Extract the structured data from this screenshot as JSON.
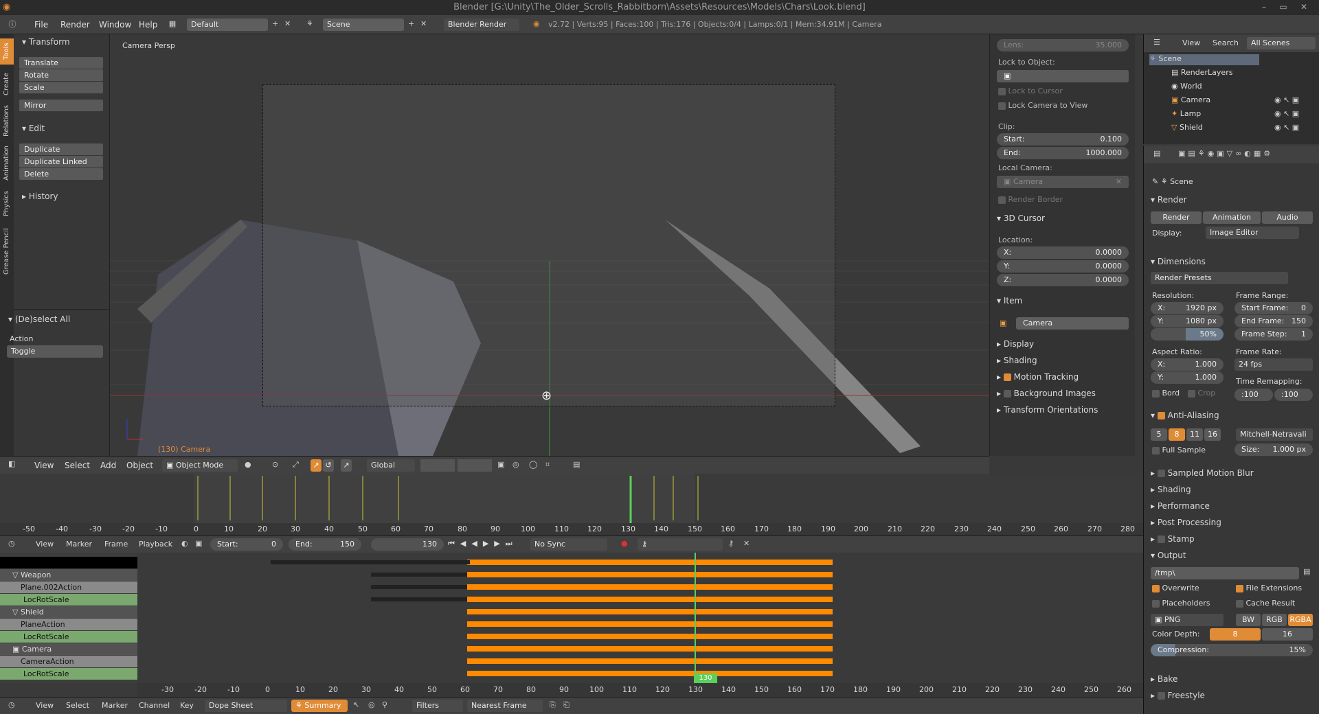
{
  "window": {
    "title": "Blender [G:\\Unity\\The_Older_Scrolls_Rabbitborn\\Assets\\Resources\\Models\\Chars\\Look.blend]"
  },
  "topbar": {
    "menus": [
      "File",
      "Render",
      "Window",
      "Help"
    ],
    "screen": "Default",
    "scene": "Scene",
    "engine": "Blender Render",
    "stats": "v2.72 | Verts:95 | Faces:100 | Tris:176 | Objects:0/4 | Lamps:0/1 | Mem:34.91M | Camera"
  },
  "toolshelf": {
    "tabs": [
      "Tools",
      "Create",
      "Relations",
      "Animation",
      "Physics",
      "Grease Pencil"
    ],
    "transform_title": "Transform",
    "transform": [
      "Translate",
      "Rotate",
      "Scale"
    ],
    "mirror": "Mirror",
    "edit_title": "Edit",
    "edit": [
      "Duplicate",
      "Duplicate Linked",
      "Delete"
    ],
    "history": "History",
    "deselect_title": "(De)select All",
    "action_label": "Action",
    "action_value": "Toggle"
  },
  "viewport": {
    "label": "Camera Persp",
    "object_label": "(130) Camera"
  },
  "npanel": {
    "lens_label": "Lens:",
    "lens": "35.000",
    "lock_obj": "Lock to Object:",
    "lock_cursor": "Lock to Cursor",
    "lock_camera": "Lock Camera to View",
    "clip": "Clip:",
    "start_label": "Start:",
    "start": "0.100",
    "end_label": "End:",
    "end": "1000.000",
    "local_camera": "Local Camera:",
    "local_camera_value": "Camera",
    "render_border": "Render Border",
    "cursor_title": "3D Cursor",
    "location": "Location:",
    "x": "0.0000",
    "y": "0.0000",
    "z": "0.0000",
    "item_title": "Item",
    "item_name": "Camera",
    "sections": [
      "Display",
      "Shading",
      "Motion Tracking",
      "Background Images",
      "Transform Orientations"
    ]
  },
  "outliner": {
    "menus": [
      "View",
      "Search",
      "All Scenes"
    ],
    "items": [
      "Scene",
      "RenderLayers",
      "World",
      "Camera",
      "Lamp",
      "Shield"
    ]
  },
  "props": {
    "scene": "Scene",
    "render_title": "Render",
    "render_btns": [
      "Render",
      "Animation",
      "Audio"
    ],
    "display_label": "Display:",
    "display": "Image Editor",
    "dimensions": "Dimensions",
    "presets": "Render Presets",
    "resolution": "Resolution:",
    "res_x": "1920 px",
    "res_y": "1080 px",
    "res_pct": "50%",
    "frame_range": "Frame Range:",
    "start_frame": "Start Frame:",
    "start_frame_v": "0",
    "end_frame": "End Frame:",
    "end_frame_v": "150",
    "frame_step": "Frame Step:",
    "frame_step_v": "1",
    "aspect": "Aspect Ratio:",
    "asp_x": "1.000",
    "asp_y": "1.000",
    "frame_rate": "Frame Rate:",
    "fps": "24 fps",
    "bord": "Bord",
    "crop": "Crop",
    "time_remap": "Time Remapping:",
    "remap_old": ":100",
    "remap_new": ":100",
    "aa": "Anti-Aliasing",
    "aa_levels": [
      "5",
      "8",
      "11",
      "16"
    ],
    "aa_filter": "Mitchell-Netravali",
    "full_sample": "Full Sample",
    "size": "Size:",
    "size_v": "1.000 px",
    "sections": [
      "Sampled Motion Blur",
      "Shading",
      "Performance",
      "Post Processing",
      "Stamp",
      "Output"
    ],
    "path": "/tmp\\",
    "overwrite": "Overwrite",
    "file_ext": "File Extensions",
    "placeholders": "Placeholders",
    "cache": "Cache Result",
    "format": "PNG",
    "color_modes": [
      "BW",
      "RGB",
      "RGBA"
    ],
    "color_depth": "Color Depth:",
    "depth_8": "8",
    "depth_16": "16",
    "compression": "Compression:",
    "compression_v": "15%",
    "bake": "Bake",
    "freestyle": "Freestyle"
  },
  "view3d_header": {
    "menus": [
      "View",
      "Select",
      "Add",
      "Object"
    ],
    "mode": "Object Mode",
    "orientation": "Global"
  },
  "timeline": {
    "ticks": [
      "-50",
      "-40",
      "-30",
      "-20",
      "-10",
      "0",
      "10",
      "20",
      "30",
      "40",
      "50",
      "60",
      "70",
      "80",
      "90",
      "100",
      "110",
      "120",
      "130",
      "140",
      "150",
      "160",
      "170",
      "180",
      "190",
      "200",
      "210",
      "220",
      "230",
      "240",
      "250",
      "260",
      "270",
      "280"
    ]
  },
  "timeline_header": {
    "menus": [
      "View",
      "Marker",
      "Frame",
      "Playback"
    ],
    "start_label": "Start:",
    "start": "0",
    "end_label": "End:",
    "end": "150",
    "current": "130",
    "sync": "No Sync"
  },
  "dopesheet": {
    "channels": [
      "Weapon",
      "Plane.002Action",
      "LocRotScale",
      "Shield",
      "PlaneAction",
      "LocRotScale",
      "Camera",
      "CameraAction",
      "LocRotScale"
    ],
    "ticks": [
      "-30",
      "-20",
      "-10",
      "0",
      "10",
      "20",
      "30",
      "40",
      "50",
      "60",
      "70",
      "80",
      "90",
      "100",
      "110",
      "120",
      "130",
      "140",
      "150",
      "160",
      "170",
      "180",
      "190",
      "200",
      "210",
      "220",
      "230",
      "240",
      "250",
      "260"
    ],
    "current": "130"
  },
  "dopesheet_header": {
    "menus": [
      "View",
      "Select",
      "Marker",
      "Channel",
      "Key"
    ],
    "mode": "Dope Sheet",
    "summary": "Summary",
    "filters": "Filters",
    "snap": "Nearest Frame"
  }
}
